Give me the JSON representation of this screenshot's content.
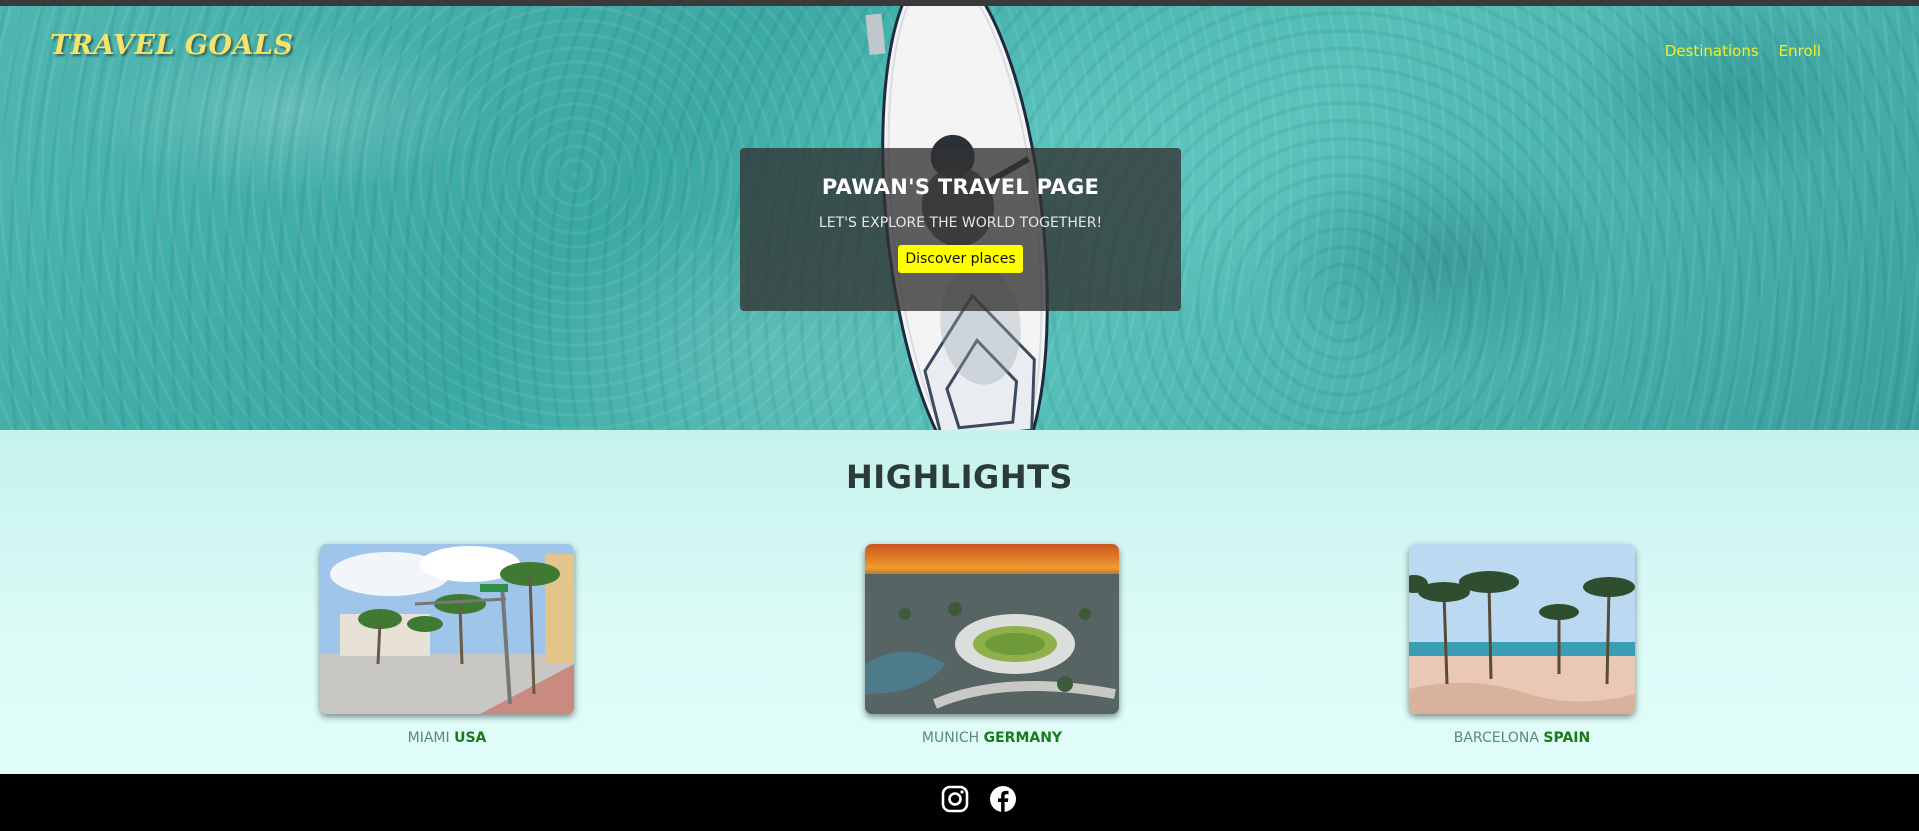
{
  "header": {
    "brand": "TRAVEL GOALS",
    "nav": [
      {
        "label": "Destinations"
      },
      {
        "label": "Enroll"
      }
    ]
  },
  "hero": {
    "title": "PAWAN'S TRAVEL PAGE",
    "subtitle": "LET'S EXPLORE THE WORLD TOGETHER!",
    "button_label": "Discover places"
  },
  "highlights": {
    "title": "HIGHLIGHTS",
    "cards": [
      {
        "city": "MIAMI",
        "country": "USA"
      },
      {
        "city": "MUNICH",
        "country": "GERMANY"
      },
      {
        "city": "BARCELONA",
        "country": "SPAIN"
      }
    ]
  },
  "footer": {
    "icons": [
      "instagram-icon",
      "facebook-icon"
    ]
  },
  "colors": {
    "brand": "#f6e36c",
    "nav": "#f0f020",
    "button": "#ffff00",
    "country": "#1b7a1b",
    "footer": "#000000"
  }
}
